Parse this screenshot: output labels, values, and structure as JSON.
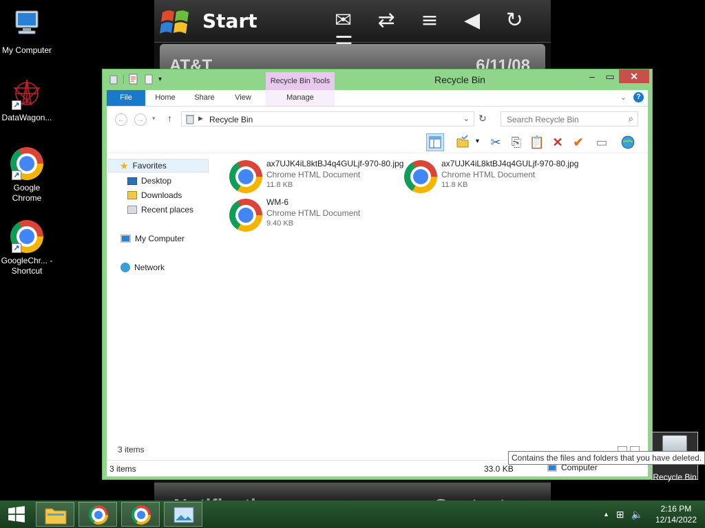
{
  "wallpaper": {
    "start_label": "Start",
    "carrier": "AT&T",
    "date": "6/11/08",
    "notification": "Notification",
    "contacts": "Contacts",
    "status_icons": "✉ ⇄ ≡ ◀ ↻ ☰"
  },
  "desktop": {
    "icons": [
      {
        "label": "My Computer"
      },
      {
        "label": "DataWagon..."
      },
      {
        "label": "Google Chrome"
      },
      {
        "label": "GoogleChr... - Shortcut"
      }
    ],
    "recycle_bin": {
      "label": "Recycle Bin"
    }
  },
  "window": {
    "title": "Recycle Bin",
    "context_tab": "Recycle Bin Tools",
    "ribbon_tabs": [
      "File",
      "Home",
      "Share",
      "View",
      "Manage"
    ],
    "address": {
      "path": "Recycle Bin"
    },
    "search": {
      "placeholder": "Search Recycle Bin"
    },
    "nav_pane": {
      "favorites": "Favorites",
      "favorites_items": [
        "Desktop",
        "Downloads",
        "Recent places"
      ],
      "my_computer": "My Computer",
      "network": "Network"
    },
    "files": [
      {
        "name": "ax7UJK4iL8ktBJ4q4GULjf-970-80.jpg",
        "type": "Chrome HTML Document",
        "size": "11.8 KB"
      },
      {
        "name": "ax7UJK4iL8ktBJ4q4GULjf-970-80.jpg",
        "type": "Chrome HTML Document",
        "size": "11.8 KB"
      },
      {
        "name": "WM-6",
        "type": "Chrome HTML Document",
        "size": "9.40 KB"
      }
    ],
    "item_count": "3 items",
    "status": {
      "count": "3 items",
      "size": "33.0 KB",
      "location": "Computer"
    }
  },
  "tooltip": "Contains the files and folders that you have deleted.",
  "taskbar": {
    "clock_time": "2:16 PM",
    "clock_date": "12/14/2022"
  },
  "colors": {
    "window_frame": "#8fd68a",
    "file_tab": "#1979ca",
    "context_tab": "#e8c8ec",
    "close_button": "#c7504b",
    "taskbar": "#1f4a27"
  }
}
